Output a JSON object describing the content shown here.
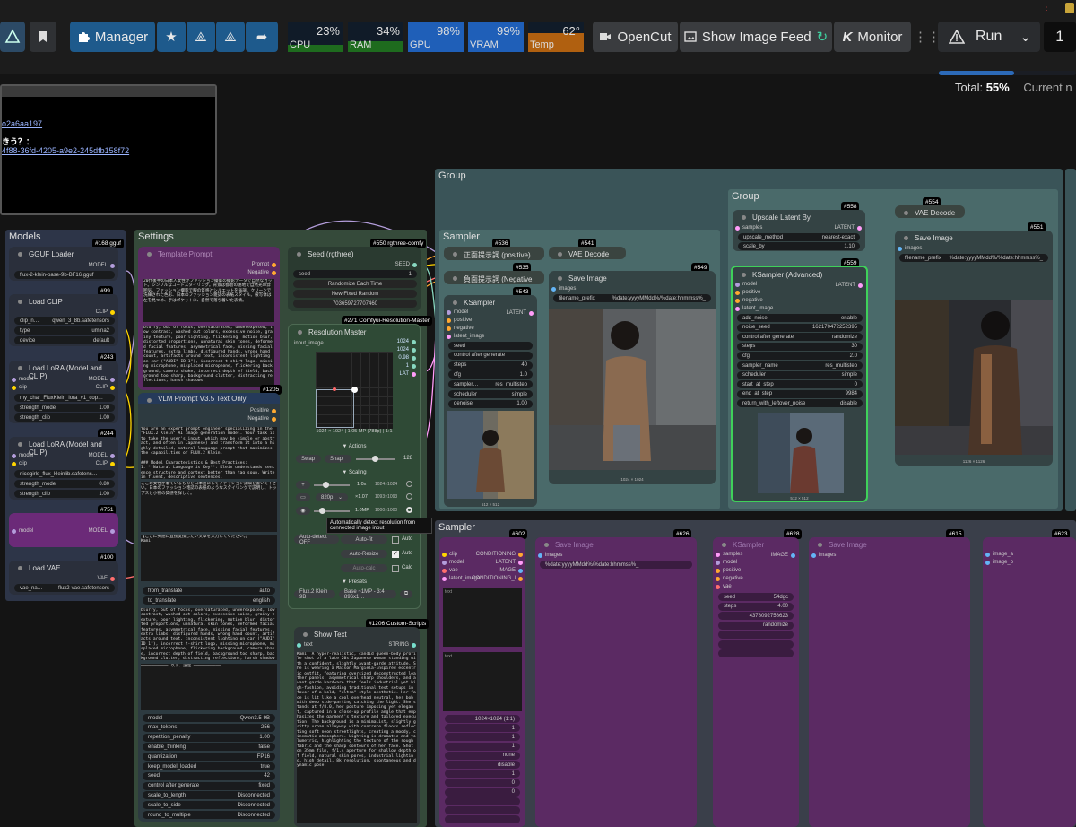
{
  "topbar": {
    "manager": "Manager",
    "opencut": "OpenCut",
    "show_feed": "Show Image Feed",
    "monitor": "Monitor",
    "run": "Run",
    "queue_count": "1",
    "monitors": [
      {
        "label": "CPU",
        "value": "23%",
        "fill": 0.23,
        "color": "#1e6b1e"
      },
      {
        "label": "RAM",
        "value": "34%",
        "fill": 0.34,
        "color": "#1e6b1e"
      },
      {
        "label": "GPU",
        "value": "98%",
        "fill": 0.98,
        "color": "#1f5fb8"
      },
      {
        "label": "VRAM",
        "value": "99%",
        "fill": 0.99,
        "color": "#1f5fb8"
      },
      {
        "label": "Temp",
        "value": "62°",
        "fill": 0.62,
        "color": "#b06010"
      }
    ]
  },
  "progress": {
    "total_label": "Total:",
    "total_value": "55%",
    "current_label": "Current n",
    "fraction": 0.55
  },
  "console": {
    "line1": "o2a6aa197",
    "line2": "きう？：",
    "line3": "4f88-36fd-4205-a9e2-245dfb158f72"
  },
  "colors": {
    "model": "#b39ddb",
    "clip": "#ffd500",
    "vae": "#ff6e6e",
    "latent": "#ff9cf9",
    "image": "#64b5f6",
    "cond": "#ffa931",
    "purple_node": "#5b2a63"
  },
  "groups": {
    "models": "Models",
    "settings": "Settings",
    "group": "Group",
    "group_inner": "Group",
    "sampler_top": "Sampler",
    "sampler_bottom": "Sampler"
  },
  "models": {
    "gguf": {
      "title": "GGUF Loader",
      "badge": "#168 gguf",
      "out": "MODEL",
      "file": "flux-2-klein-base-9b-BF16.gguf"
    },
    "clip": {
      "title": "Load CLIP",
      "badge": "#99",
      "out": "CLIP",
      "name_l": "clip_n…",
      "name_v": "qwen_3_8b.safetensors",
      "type_l": "type",
      "type_v": "lumina2",
      "dev_l": "device",
      "dev_v": "default"
    },
    "lora1": {
      "title": "Load LoRA (Model and CLIP)",
      "badge": "#243",
      "in1": "model",
      "in2": "clip",
      "out1": "MODEL",
      "out2": "CLIP",
      "file": "my_char_FluxKlein_lora_v1_cop…",
      "sm_l": "strength_model",
      "sm_v": "1.00",
      "sc_l": "strength_clip",
      "sc_v": "1.00"
    },
    "lora2": {
      "title": "Load LoRA (Model and CLIP)",
      "badge": "#244",
      "in1": "model",
      "in2": "clip",
      "out1": "MODEL",
      "out2": "CLIP",
      "file": "nicegirls_flux_kleinlib.safetens…",
      "sm_l": "strength_model",
      "sm_v": "0.80",
      "sc_l": "strength_clip",
      "sc_v": "1.00"
    },
    "bypass": {
      "in": "model",
      "out": "MODEL",
      "badge": "#751"
    },
    "vae": {
      "title": "Load VAE",
      "badge": "#100",
      "out": "VAE",
      "name_l": "vae_na…",
      "name_v": "flux2-vae.safetensors"
    }
  },
  "settings": {
    "prompt_title": "Template Prompt",
    "prompt_badge": "#150",
    "out1": "Prompt",
    "out2": "Negative",
    "prompt_text": "20代後半の日本人女性がファッション撮影の撮影データで自然なカット。シンプルなコートスタイリング。背景は都会の路地で自然光の雰囲気。ファッション撮影で服の質感とシルエットを強調。クリーンで洗練された色彩、日本のファッション雑誌の表紙スタイル。被写体は左を見つめ、手はポケットに、自然で落ち着いた表情。",
    "neg_text": "blurry, out of focus, oversaturated, underexposed, low contrast, washed out colors, excessive noise, grainy texture, poor lighting, flickering, motion blur, distorted proportions, unnatural skin tones, deformed facial features, asymmetrical face, missing facial features, extra limbs, disfigured hands, wrong hand count, artifacts around text, inconsistent lighting on car (\"AUDI\" ID 1\"), incorrect t-shirt logo, missing microphone, misplaced microphone, flickering background, camera shake, incorrect depth of field, background too sharp, background clutter, distracting reflections, harsh shadows.",
    "vlm_title": "VLM Prompt V3.5 Text Only",
    "vlm_badge": "#1205",
    "vlm_out1": "Positive",
    "vlm_out2": "Negative",
    "sys_text": "You are an expert prompt engineer specializing in the \"FLUX.2 Klein\" AI image generation model. Your task is to take the user's input (which may be simple or abstract, and often in Japanese) and transform it into a highly detailed, natural language prompt that maximizes the capabilities of FLUX.2 Klein.\n\n### Model Characteristics & Best Practices:\n1. **Natural Language is Key**: Klein understands sentence structure and context better than tag soup. Write in fluent, descriptive sentences.",
    "user_text": "ここの女性が着ているものを日本語にしてファッション詳細を書いて下さい。日本のファッション雑誌の表紙のようなスタイリングで説明し、トップスと小物の質感を詳しく。",
    "user2_text": "【ここに英語に直接変換したい文章を入力してください。】\nKami.",
    "from_l": "from_translate",
    "from_v": "auto",
    "to_l": "to_translate",
    "to_v": "english",
    "neg2_text": "blurry, out of focus, oversaturated, underexposed, low contrast, washed out colors, excessive noise, grainy texture, poor lighting, flickering, motion blur, distorted proportions, unnatural skin tones, deformed facial features, asymmetrical face, missing facial features, extra limbs, disfigured hands, wrong hand count, artifacts around text, inconsistent lighting on car (\"AUDI\" ID 1\"), incorrect t-shirt logo, missing microphone, misplaced microphone, flickering background, camera shake, incorrect depth of field, background too sharp, background clutter, distracting reflections, harsh shadows.",
    "sep_text": "─────────── 以下、設定 ───────────",
    "params": [
      [
        "model",
        "Qwen3.5-9B"
      ],
      [
        "max_tokens",
        "256"
      ],
      [
        "repetition_penalty",
        "1.00"
      ],
      [
        "enable_thinking",
        "false"
      ],
      [
        "quantization",
        "FP16"
      ],
      [
        "keep_model_loaded",
        "true"
      ],
      [
        "seed",
        "42"
      ],
      [
        "control after generate",
        "fixed"
      ],
      [
        "scale_to_length",
        "Disconnected"
      ],
      [
        "scale_to_side",
        "Disconnected"
      ],
      [
        "round_to_multiple",
        "Disconnected"
      ]
    ]
  },
  "seed": {
    "badge": "#550 rgthree-comfy",
    "title": "Seed (rgthree)",
    "out": "SEED",
    "seed_l": "seed",
    "seed_v": "-1",
    "b1": "Randomize Each Time",
    "b2": "New Fixed Random",
    "b3": "703659727707460"
  },
  "resmaster": {
    "badge": "#271 Comfyui-Resolution-Master",
    "title": "Resolution Master",
    "input": "input_image",
    "o1": "1024",
    "o2": "1024",
    "o3": "0.98",
    "o4": "1",
    "o5": "LAT",
    "dims": "1024 × 1024  |  1.05 MP (788p)  |  1:1",
    "actions": "▼ Actions",
    "swap1": "Swap",
    "swap2": "Snap",
    "snapv": "128",
    "scaling": "▼ Scaling",
    "s1": "1.0x",
    "s1r": "1024×1024",
    "s2": "820p",
    "s2x": "×1.07",
    "s2r": "1093×1093",
    "s3": "1.0MP",
    "s3r": "1000×1000",
    "tooltip": "Automatically detect resolution from connected image input",
    "autodetect": "Auto-detect OFF",
    "autofit": "Auto-fit",
    "autoresize": "Auto-Resize",
    "autocalc": "Auto-calc",
    "auto1": "Auto",
    "auto2": "Auto",
    "calc": "Calc",
    "presets": "▼ Presets",
    "p1": "Flux.2 Klein 9B",
    "p2": "Base ~1MP - 3:4 896x1…"
  },
  "showtext": {
    "badge": "#1206 Custom-Scripts",
    "title": "Show Text",
    "in": "text",
    "out": "STRING",
    "text": "Kami, A hyper-realistic, candid queen-body profile shot of a late 20s Japanese woman standing with a confident, slightly avant-garde attitude. She is wearing a Maison Margiela-inspired eccentric outfit, featuring oversized deconstructed leather panels, asymmetrical sharp shoulders, and avant-garde hardware that feels industrial yet high-fashion, avoiding traditional test setups in favor of a bold, \"ultra\" style aesthetic. Her face is lit like a cool overhead neutral, her bob with deep side-parting catching the light. She stands at f/8.0, her posture imposing yet elegant, captured in a close-up profile angle that emphasizes the garment's texture and tailored execution. The background is a minimalist, slightly gritty urban alleyway with concrete floors reflecting soft neon streetlights, creating a moody, cinematic atmosphere. Lighting is dramatic and volumetric, highlighting the texture of the rough fabric and the sharp contours of her face. Shot on 35mm film, f/1.4 aperture for shallow depth of field, natural skin pores, industrial lighting, high detail, 8k resolution, spontaneous and dynamic pose."
  },
  "sampler": {
    "pos_badge": "#536",
    "pos_title": "正面提示詞 (positive)",
    "neg_badge": "#535",
    "neg_title": "負面提示詞 (Negative Prom",
    "b543": "#543",
    "ks_title": "KSampler",
    "ks_out": "LATENT",
    "ins": [
      "model",
      "positive",
      "negative",
      "latent_image"
    ],
    "ks_w": [
      [
        "seed",
        ""
      ],
      [
        "control after generate",
        ""
      ],
      [
        "steps",
        "40"
      ],
      [
        "cfg",
        "1.0"
      ],
      [
        "sampler…",
        "res_multistep"
      ],
      [
        "scheduler",
        "simple"
      ],
      [
        "denoise",
        "1.00"
      ]
    ],
    "thumb_dims": "512 × 512",
    "vd_badge": "#541",
    "vd_title": "VAE Decode",
    "save_badge": "#549",
    "save_title": "Save Image",
    "images": "images",
    "fp_l": "filename_prefix",
    "fp_v": "%date:yyyyMMdd%/%date:hhmmss%_",
    "photo_dims": "1024 × 1024"
  },
  "inner": {
    "up_badge": "#558",
    "up_title": "Upscale Latent By",
    "up_out": "LATENT",
    "up_in": "samples",
    "um_l": "upscale_method",
    "um_v": "nearest-exact",
    "sb_l": "scale_by",
    "sb_v": "1.10",
    "ksa_badge": "#559",
    "ksa_title": "KSampler (Advanced)",
    "ksa_out": "LATENT",
    "ksa_ins": [
      "model",
      "positive",
      "negative",
      "latent_image"
    ],
    "ksa_w": [
      [
        "add_noise",
        "enable"
      ],
      [
        "noise_seed",
        "162170472252395"
      ],
      [
        "control after generate",
        "randomize"
      ],
      [
        "steps",
        "30"
      ],
      [
        "cfg",
        "2.0"
      ],
      [
        "sampler_name",
        "res_multistep"
      ],
      [
        "scheduler",
        "simple"
      ],
      [
        "start_at_step",
        "0"
      ],
      [
        "end_at_step",
        "9984"
      ],
      [
        "return_with_leftover_noise",
        "disable"
      ]
    ],
    "thumb_dims": "512 × 512",
    "vd_badge": "#554",
    "vd_title": "VAE Decode",
    "save_badge": "#551",
    "save_title": "Save Image",
    "images": "images",
    "fp_l": "filename_prefix",
    "fp_v": "%date:yyyyMMdd%/%date:hhmmss%_",
    "photo_dims": "1126 × 1126"
  },
  "bottom": {
    "n1_badge": "#602",
    "n1_ins": [
      "clip",
      "model",
      "vae",
      "latent_image"
    ],
    "n1_outs": [
      "CONDITIONING",
      "LATENT",
      "IMAGE",
      "CONDITIONING_l"
    ],
    "n1_text1": "text",
    "n1_text2": "text",
    "n2_badge": "#626",
    "n2_title": "Save Image",
    "n2_in": "images",
    "n2_fp": "%date:yyyyMMdd%/%date:hhmmss%_",
    "n3_badge": "#628",
    "n3_title": "KSampler",
    "n3_ins": [
      "samples",
      "model",
      "positive",
      "negative",
      "vae"
    ],
    "n3_out": "IMAGE",
    "n4_badge": "#615",
    "n4_title": "Save Image",
    "n4_in": "images",
    "n5_badge": "#623",
    "n5_ins": [
      "image_a",
      "image_b"
    ],
    "n3_w": [
      [
        "seed",
        "54dgc"
      ],
      [
        "steps",
        "4.00"
      ],
      [
        "",
        "4378092758623"
      ],
      [
        "",
        "randomize"
      ],
      [
        "",
        ""
      ],
      [
        "",
        ""
      ],
      [
        "",
        ""
      ]
    ],
    "n1_w": [
      [
        "",
        "1024×1024 (1:1)"
      ],
      [
        "",
        "1"
      ],
      [
        "",
        "1"
      ],
      [
        "",
        "1"
      ],
      [
        "",
        "none"
      ],
      [
        "",
        "disable"
      ],
      [
        "",
        "1"
      ],
      [
        "",
        "0"
      ],
      [
        "",
        "0"
      ],
      [
        "",
        ""
      ],
      [
        "",
        ""
      ],
      [
        "",
        ""
      ]
    ]
  }
}
